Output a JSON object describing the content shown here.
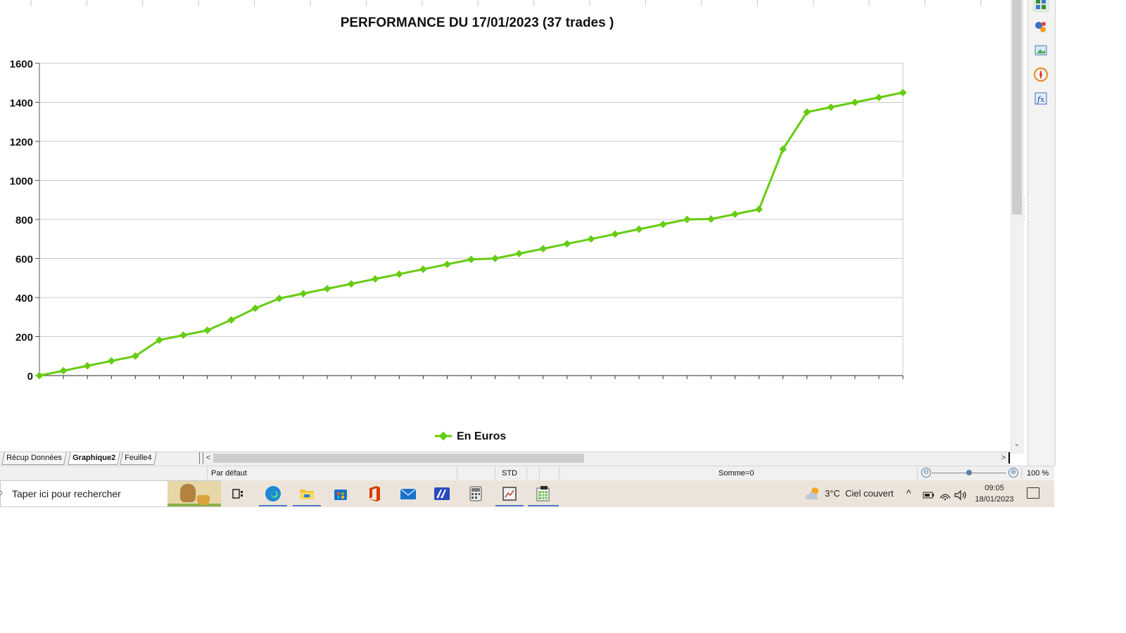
{
  "chart_data": {
    "type": "line",
    "title": "PERFORMANCE DU 17/01/2023 (37 trades )",
    "xlabel": "",
    "ylabel": "",
    "ylim": [
      0,
      1600
    ],
    "yticks": [
      0,
      200,
      400,
      600,
      800,
      1000,
      1200,
      1400,
      1600
    ],
    "grid": true,
    "legend_position": "bottom",
    "series": [
      {
        "name": "En Euros",
        "color": "#66cc11",
        "marker": "diamond",
        "values": [
          0,
          25,
          50,
          75,
          100,
          182,
          207,
          232,
          285,
          345,
          395,
          420,
          445,
          470,
          495,
          520,
          545,
          570,
          595,
          600,
          625,
          650,
          675,
          700,
          725,
          750,
          775,
          800,
          802,
          827,
          852,
          1160,
          1350,
          1375,
          1400,
          1425,
          1450
        ]
      }
    ]
  },
  "sheet_tabs": [
    {
      "label": "Récup Données",
      "active": false
    },
    {
      "label": "Graphique2",
      "active": true
    },
    {
      "label": "Feuille4",
      "active": false
    }
  ],
  "status_bar": {
    "style": "Par défaut",
    "mode": "STD",
    "sum": "Somme=0",
    "zoom_out": "⊖",
    "zoom_in": "⊕",
    "zoom": "100 %",
    "zoom_level": 0.5
  },
  "scroll": {
    "left_arrow": "<",
    "right_arrow": ">",
    "down_arrow": "⌄"
  },
  "taskbar": {
    "search_placeholder": "Taper ici pour rechercher",
    "weather_temp": "3°C",
    "weather_text": "Ciel couvert",
    "time": "09:05",
    "date": "18/01/2023",
    "tray_chevron": "^"
  },
  "colors": {
    "series": "#66cc11",
    "grid": "#c8c8c8",
    "taskbar": "#ece4da"
  }
}
